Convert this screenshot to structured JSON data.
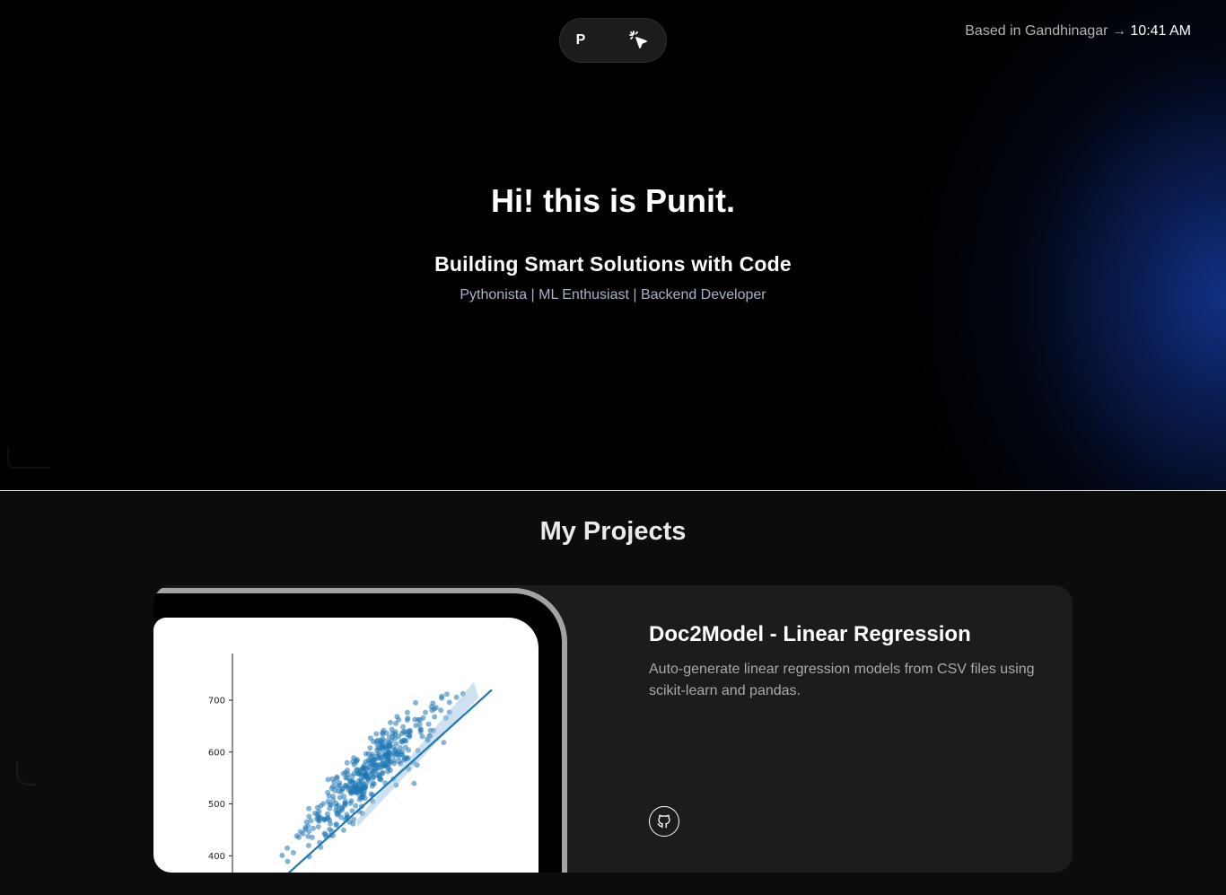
{
  "nav": {
    "logo": "P",
    "cursor_icon": "sparkle-cursor-icon"
  },
  "location": {
    "prefix": "Based in Gandhinagar",
    "arrow": "→",
    "time": "10:41 AM"
  },
  "hero": {
    "title": "Hi! this is Punit.",
    "subtitle": "Building Smart Solutions with Code",
    "tagline": "Pythonista | ML Enthusiast | Backend Developer"
  },
  "projects": {
    "heading": "My Projects",
    "items": [
      {
        "title": "Doc2Model - Linear Regression",
        "description": "Auto-generate linear regression models from CSV files using scikit-learn and pandas.",
        "link_icon": "github-icon",
        "preview": {
          "chart_data": {
            "type": "scatter",
            "y_ticks": [
              "700",
              "600",
              "500",
              "400"
            ],
            "ylim": [
              340,
              790
            ],
            "regression_line": {
              "from": [
                0.05,
                355
              ],
              "to": [
                0.95,
                720
              ]
            },
            "color": "#1f77b4"
          }
        }
      }
    ]
  },
  "colors": {
    "hero_bg": "#000000",
    "section_bg": "#0c0c0c",
    "card_bg": "#1c1c1c",
    "accent_glow": "#12348c",
    "scatter": "#1f77b4"
  }
}
